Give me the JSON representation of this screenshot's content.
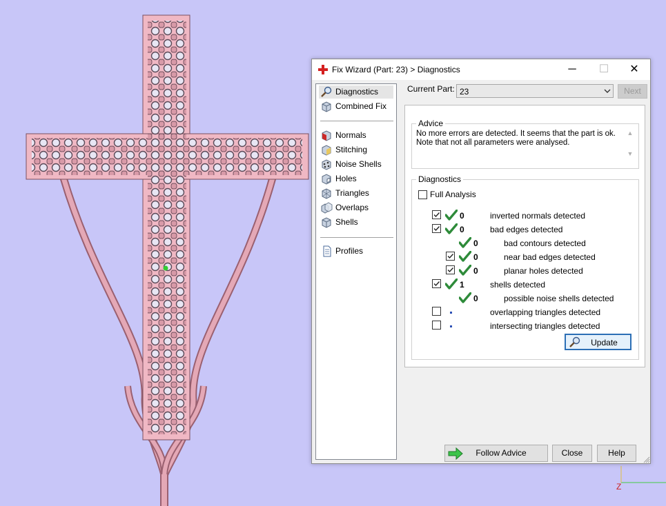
{
  "window": {
    "title": "Fix Wizard (Part: 23) > Diagnostics",
    "controls": {
      "minimize": "─",
      "maximize": "☐",
      "close": "✕"
    }
  },
  "nav": {
    "top_items": [
      {
        "label": "Diagnostics",
        "icon": "magnifier-icon",
        "selected": true
      },
      {
        "label": "Combined Fix",
        "icon": "cube-icon"
      }
    ],
    "fix_items": [
      {
        "label": "Normals",
        "icon": "normals-cube-icon"
      },
      {
        "label": "Stitching",
        "icon": "stitching-cube-icon"
      },
      {
        "label": "Noise Shells",
        "icon": "noise-shells-icon"
      },
      {
        "label": "Holes",
        "icon": "holes-cube-icon"
      },
      {
        "label": "Triangles",
        "icon": "triangles-icon"
      },
      {
        "label": "Overlaps",
        "icon": "overlaps-icon"
      },
      {
        "label": "Shells",
        "icon": "shells-icon"
      }
    ],
    "bottom_items": [
      {
        "label": "Profiles",
        "icon": "profiles-document-icon"
      }
    ]
  },
  "current_part": {
    "label": "Current Part:",
    "value": "23"
  },
  "next_button": "Next",
  "advice": {
    "title": "Advice",
    "line1": "No more errors are detected. It seems that the part is ok.",
    "line2": "Note that not all parameters were analysed."
  },
  "diagnostics": {
    "title": "Diagnostics",
    "full_analysis": {
      "label": "Full Analysis",
      "checked": false
    },
    "rows": [
      {
        "checked": true,
        "has_checkbox": true,
        "status": "ok",
        "count": "0",
        "label": "inverted normals detected",
        "indent": 0
      },
      {
        "checked": true,
        "has_checkbox": true,
        "status": "ok",
        "count": "0",
        "label": "bad edges detected",
        "indent": 0
      },
      {
        "checked": false,
        "has_checkbox": false,
        "status": "ok",
        "count": "0",
        "label": "bad contours detected",
        "indent": 1
      },
      {
        "checked": true,
        "has_checkbox": true,
        "status": "ok",
        "count": "0",
        "label": "near bad edges detected",
        "indent": 1
      },
      {
        "checked": true,
        "has_checkbox": true,
        "status": "ok",
        "count": "0",
        "label": "planar holes detected",
        "indent": 1
      },
      {
        "checked": true,
        "has_checkbox": true,
        "status": "ok",
        "count": "1",
        "label": "shells detected",
        "indent": 0
      },
      {
        "checked": false,
        "has_checkbox": false,
        "status": "ok",
        "count": "0",
        "label": "possible noise shells detected",
        "indent": 1
      },
      {
        "checked": false,
        "has_checkbox": true,
        "status": "pending",
        "count": "",
        "label": "overlapping triangles detected",
        "indent": 0
      },
      {
        "checked": false,
        "has_checkbox": true,
        "status": "pending",
        "count": "",
        "label": "intersecting triangles detected",
        "indent": 0
      }
    ],
    "update_button": "Update"
  },
  "footer": {
    "follow_advice": "Follow Advice",
    "close": "Close",
    "help": "Help"
  },
  "axis": {
    "z_label": "Z"
  },
  "colors": {
    "background": "#c8c6f8",
    "model_fill": "#f0b8c4",
    "model_stroke": "#b87a8a",
    "check_green": "#2e8b3a",
    "arrow_green": "#3cc44a",
    "brand_red": "#d42020"
  }
}
